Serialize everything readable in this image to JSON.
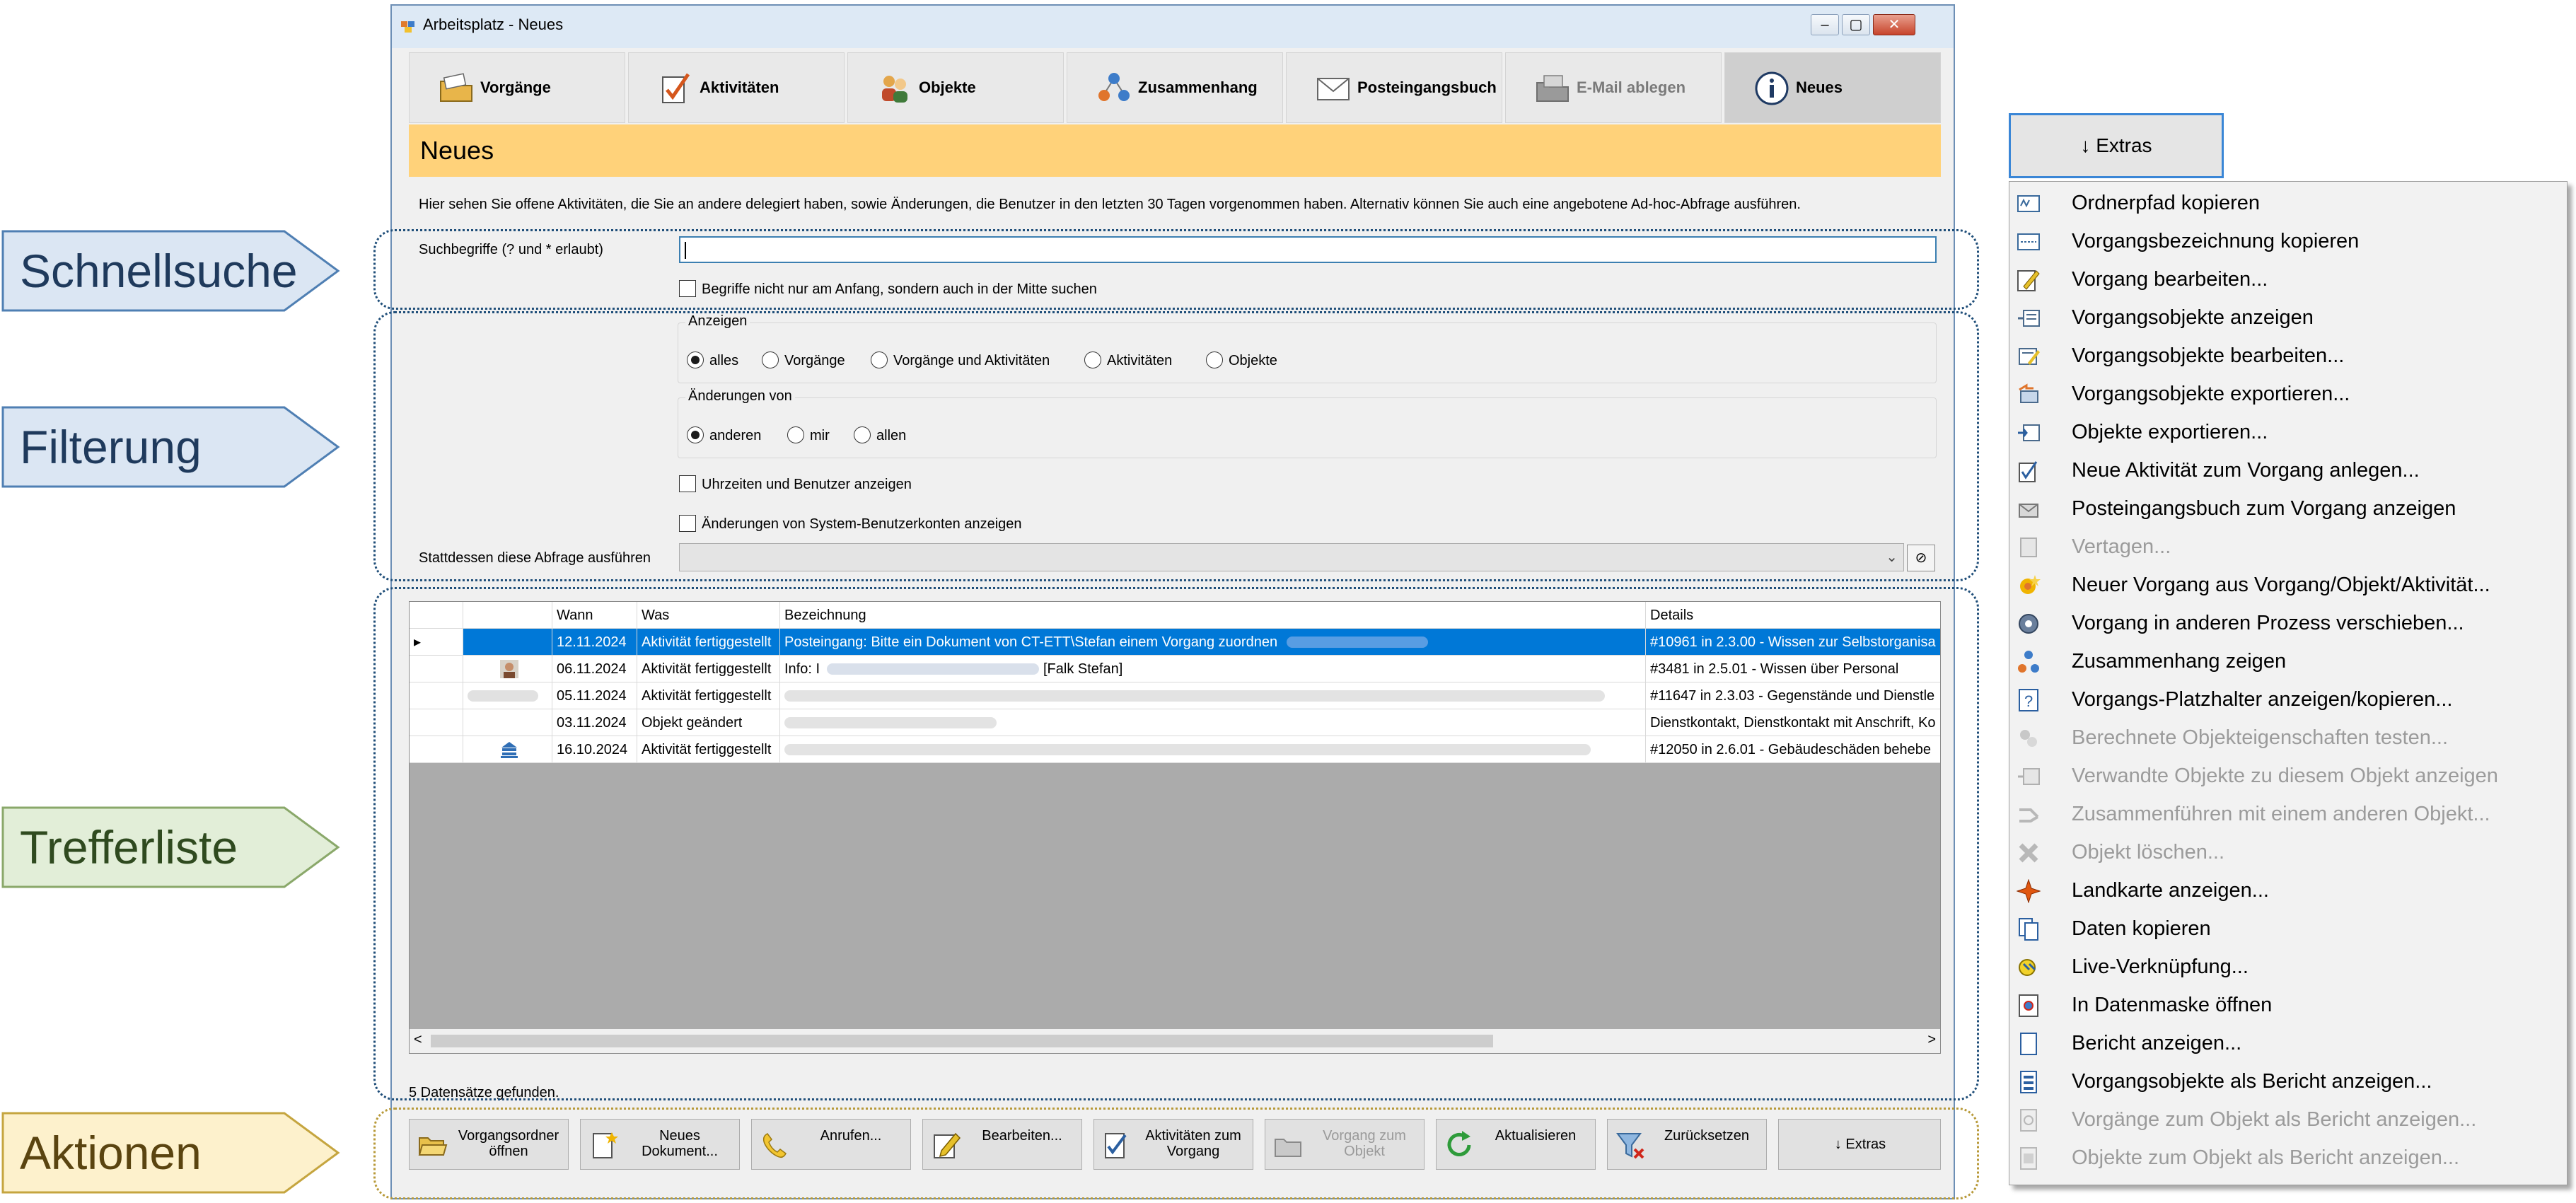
{
  "callouts": [
    {
      "label": "Schnellsuche",
      "fill": "#dbe6f3",
      "stroke": "#4f7fb3"
    },
    {
      "label": "Filterung",
      "fill": "#dbe6f3",
      "stroke": "#4f7fb3"
    },
    {
      "label": "Trefferliste",
      "fill": "#e2eed8",
      "stroke": "#8aa86a"
    },
    {
      "label": "Aktionen",
      "fill": "#fdf1cc",
      "stroke": "#c5a53f"
    }
  ],
  "window": {
    "title": "Arbeitsplatz - Neues",
    "controls": {
      "minimize": "–",
      "maximize": "▢",
      "close": "✕"
    }
  },
  "tabs": [
    {
      "label": "Vorgänge",
      "icon": "folder-icon",
      "state": "normal"
    },
    {
      "label": "Aktivitäten",
      "icon": "checkmark-icon",
      "state": "normal"
    },
    {
      "label": "Objekte",
      "icon": "people-icon",
      "state": "normal"
    },
    {
      "label": "Zusammenhang",
      "icon": "network-icon",
      "state": "normal"
    },
    {
      "label": "Posteingangsbuch",
      "icon": "envelope-icon",
      "state": "normal"
    },
    {
      "label": "E-Mail ablegen",
      "icon": "mail-folder-icon",
      "state": "disabled"
    },
    {
      "label": "Neues",
      "icon": "info-icon",
      "state": "active"
    }
  ],
  "banner": {
    "title": "Neues",
    "color": "#ffd27a"
  },
  "intro": "Hier sehen Sie offene Aktivitäten, die Sie an andere delegiert haben, sowie Änderungen, die Benutzer in den letzten 30 Tagen vorgenommen haben. Alternativ können Sie auch eine angebotene Ad-hoc-Abfrage ausführen.",
  "search": {
    "label": "Suchbegriffe (? und * erlaubt)",
    "value": "",
    "middle_search": {
      "label": "Begriffe nicht nur am Anfang, sondern auch in der Mitte suchen",
      "checked": false
    }
  },
  "filter": {
    "anzeigen": {
      "title": "Anzeigen",
      "options": [
        {
          "label": "alles",
          "selected": true
        },
        {
          "label": "Vorgänge",
          "selected": false
        },
        {
          "label": "Vorgänge und Aktivitäten",
          "selected": false
        },
        {
          "label": "Aktivitäten",
          "selected": false
        },
        {
          "label": "Objekte",
          "selected": false
        }
      ]
    },
    "aenderungen": {
      "title": "Änderungen von",
      "options": [
        {
          "label": "anderen",
          "selected": true
        },
        {
          "label": "mir",
          "selected": false
        },
        {
          "label": "allen",
          "selected": false
        }
      ]
    },
    "uhrzeiten": {
      "label": "Uhrzeiten und Benutzer anzeigen",
      "checked": false
    },
    "system": {
      "label": "Änderungen von System-Benutzerkonten anzeigen",
      "checked": false
    },
    "query": {
      "label": "Stattdessen diese Abfrage ausführen",
      "value": ""
    }
  },
  "grid": {
    "columns": [
      "",
      "",
      "Wann",
      "Was",
      "Bezeichnung",
      "Details"
    ],
    "rows": [
      {
        "selected": true,
        "marker": "▸",
        "icon": "",
        "wann": "12.11.2024",
        "was": "Aktivität fertiggestellt",
        "bezeichnung": "Posteingang: Bitte ein Dokument von CT-ETT\\Stefan einem Vorgang zuordnen",
        "details": "#10961 in 2.3.00 - Wissen zur Selbstorganisa"
      },
      {
        "selected": false,
        "marker": "",
        "icon": "person-icon",
        "wann": "06.11.2024",
        "was": "Aktivität fertiggestellt",
        "bezeichnung": "Info: I",
        "bezeichnung_suffix": "[Falk Stefan]",
        "details": "#3481 in 2.5.01 - Wissen über Personal"
      },
      {
        "selected": false,
        "marker": "",
        "icon": "blurred-icon",
        "wann": "05.11.2024",
        "was": "Aktivität fertiggestellt",
        "bezeichnung": "",
        "details": "#11647 in 2.3.03 - Gegenstände und Dienstle"
      },
      {
        "selected": false,
        "marker": "",
        "icon": "",
        "wann": "03.11.2024",
        "was": "Objekt geändert",
        "bezeichnung": "",
        "details": "Dienstkontakt, Dienstkontakt mit Anschrift, Ko"
      },
      {
        "selected": false,
        "marker": "",
        "icon": "building-icon",
        "wann": "16.10.2024",
        "was": "Aktivität fertiggestellt",
        "bezeichnung": "",
        "details": "#12050 in 2.6.01 - Gebäudeschäden behebe"
      }
    ],
    "scroll_left": "<",
    "scroll_right": ">",
    "status": "5 Datensätze gefunden."
  },
  "actions": [
    {
      "label": "Vorgangsordner öffnen",
      "icon": "folder-open-icon",
      "disabled": false
    },
    {
      "label": "Neues Dokument...",
      "icon": "new-document-icon",
      "disabled": false
    },
    {
      "label": "Anrufen...",
      "icon": "phone-icon",
      "disabled": false
    },
    {
      "label": "Bearbeiten...",
      "icon": "edit-icon",
      "disabled": false
    },
    {
      "label": "Aktivitäten zum Vorgang",
      "icon": "checklist-icon",
      "disabled": false
    },
    {
      "label": "Vorgang zum Objekt",
      "icon": "folder-link-icon",
      "disabled": true
    },
    {
      "label": "Aktualisieren",
      "icon": "refresh-icon",
      "disabled": false
    },
    {
      "label": "Zurücksetzen",
      "icon": "filter-reset-icon",
      "disabled": false
    },
    {
      "label": "↓ Extras",
      "icon": "",
      "disabled": false
    }
  ],
  "extras": {
    "button_label": "↓ Extras",
    "items": [
      {
        "label": "Ordnerpfad kopieren",
        "icon": "path-copy-icon",
        "disabled": false
      },
      {
        "label": "Vorgangsbezeichnung kopieren",
        "icon": "text-copy-icon",
        "disabled": false
      },
      {
        "label": "Vorgang bearbeiten...",
        "icon": "pencil-icon",
        "disabled": false
      },
      {
        "label": "Vorgangsobjekte anzeigen",
        "icon": "list-icon",
        "disabled": false
      },
      {
        "label": "Vorgangsobjekte bearbeiten...",
        "icon": "list-edit-icon",
        "disabled": false
      },
      {
        "label": "Vorgangsobjekte exportieren...",
        "icon": "export-icon",
        "disabled": false
      },
      {
        "label": "Objekte exportieren...",
        "icon": "objects-export-icon",
        "disabled": false
      },
      {
        "label": "Neue Aktivität zum Vorgang anlegen...",
        "icon": "new-activity-icon",
        "disabled": false
      },
      {
        "label": "Posteingangsbuch zum Vorgang anzeigen",
        "icon": "inbox-icon",
        "disabled": false
      },
      {
        "label": "Vertagen...",
        "icon": "postpone-icon",
        "disabled": true
      },
      {
        "label": "Neuer Vorgang aus Vorgang/Objekt/Aktivität...",
        "icon": "new-case-icon",
        "disabled": false
      },
      {
        "label": "Vorgang in anderen Prozess verschieben...",
        "icon": "move-icon",
        "disabled": false
      },
      {
        "label": "Zusammenhang zeigen",
        "icon": "network-icon",
        "disabled": false
      },
      {
        "label": "Vorgangs-Platzhalter anzeigen/kopieren...",
        "icon": "question-icon",
        "disabled": false
      },
      {
        "label": "Berechnete Objekteigenschaften testen...",
        "icon": "calc-icon",
        "disabled": true
      },
      {
        "label": "Verwandte Objekte zu diesem Objekt anzeigen",
        "icon": "related-icon",
        "disabled": true
      },
      {
        "label": "Zusammenführen mit einem anderen Objekt...",
        "icon": "merge-icon",
        "disabled": true
      },
      {
        "label": "Objekt löschen...",
        "icon": "delete-icon",
        "disabled": true
      },
      {
        "label": "Landkarte anzeigen...",
        "icon": "map-star-icon",
        "disabled": false
      },
      {
        "label": "Daten kopieren",
        "icon": "copy-icon",
        "disabled": false
      },
      {
        "label": "Live-Verknüpfung...",
        "icon": "live-link-icon",
        "disabled": false
      },
      {
        "label": "In Datenmaske öffnen",
        "icon": "form-icon",
        "disabled": false
      },
      {
        "label": "Bericht anzeigen...",
        "icon": "report-icon",
        "disabled": false
      },
      {
        "label": "Vorgangsobjekte als Bericht anzeigen...",
        "icon": "report-list-icon",
        "disabled": false
      },
      {
        "label": "Vorgänge zum Objekt als Bericht anzeigen...",
        "icon": "report-case-icon",
        "disabled": true
      },
      {
        "label": "Objekte zum Objekt als Bericht anzeigen...",
        "icon": "report-object-icon",
        "disabled": true
      }
    ]
  }
}
